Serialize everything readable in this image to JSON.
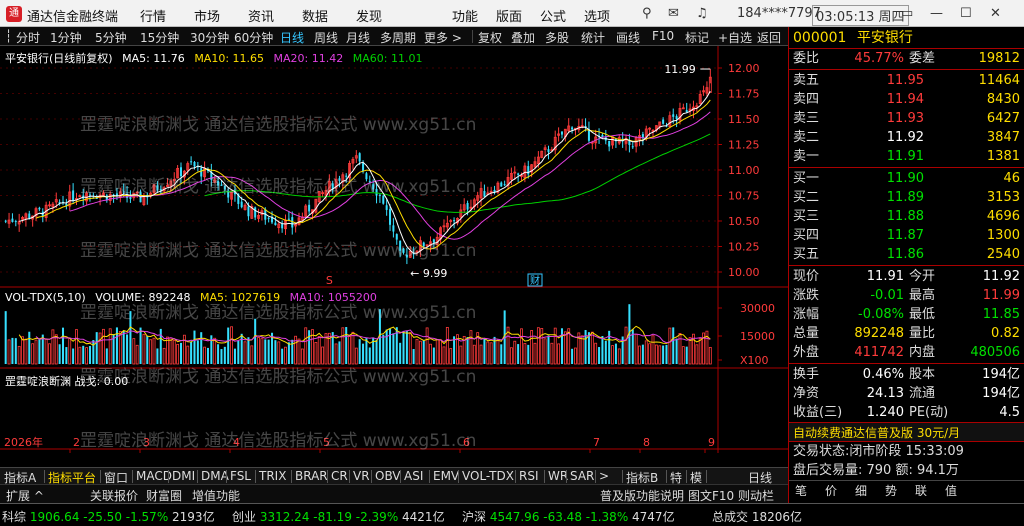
{
  "titlebar": {
    "logo": "通",
    "app_title": "通达信金融终端",
    "account": "184****7797",
    "time": "03:05:13 周四"
  },
  "menu": [
    "行情",
    "市场",
    "资讯",
    "数据",
    "发现",
    "功能",
    "版面",
    "公式",
    "选项"
  ],
  "toolbar": {
    "items": [
      "分时",
      "1分钟",
      "5分钟",
      "15分钟",
      "30分钟",
      "60分钟",
      "日线",
      "周线",
      "月线",
      "多周期",
      "更多 >",
      "复权",
      "叠加",
      "多股",
      "统计",
      "画线",
      "F10",
      "标记",
      "+自选",
      "返回"
    ],
    "active": "日线"
  },
  "chart": {
    "title": "平安银行(日线前复权)",
    "ma5": "MA5: 11.76",
    "ma10": "MA10: 11.65",
    "ma20": "MA20: 11.42",
    "ma60": "MA60: 11.01",
    "high_label": "11.99",
    "low_label": "9.99",
    "s_mark": "S",
    "cai_mark": "财",
    "year": "2026年",
    "months": [
      "2",
      "3",
      "4",
      "5",
      "6",
      "7",
      "8",
      "9"
    ],
    "price_ticks": [
      "12.00",
      "11.75",
      "11.50",
      "11.25",
      "11.00",
      "10.75",
      "10.50",
      "10.25",
      "10.00"
    ],
    "vol_legend": "VOL-TDX(5,10)",
    "volume": "VOLUME: 892248",
    "vol_ma5": "MA5: 1027619",
    "vol_ma10": "MA10: 1055200",
    "vol_ticks": [
      "30000",
      "15000",
      "X100"
    ],
    "ind_legend": "罡霆啶浪断渊 战戈: 0.00",
    "watermark": "罡霆啶浪断渊戈 通达信选股指标公式 www.xg51.cn"
  },
  "quote": {
    "code": "000001",
    "name": "平安银行",
    "weibi_label": "委比",
    "weibi": "45.77%",
    "weicha_label": "委差",
    "weicha": "19812",
    "sells": [
      {
        "label": "卖五",
        "price": "11.95",
        "vol": "11464"
      },
      {
        "label": "卖四",
        "price": "11.94",
        "vol": "8430"
      },
      {
        "label": "卖三",
        "price": "11.93",
        "vol": "6427"
      },
      {
        "label": "卖二",
        "price": "11.92",
        "vol": "3847"
      },
      {
        "label": "卖一",
        "price": "11.91",
        "vol": "1381"
      }
    ],
    "buys": [
      {
        "label": "买一",
        "price": "11.90",
        "vol": "46"
      },
      {
        "label": "买二",
        "price": "11.89",
        "vol": "3153"
      },
      {
        "label": "买三",
        "price": "11.88",
        "vol": "4696"
      },
      {
        "label": "买四",
        "price": "11.87",
        "vol": "1300"
      },
      {
        "label": "买五",
        "price": "11.86",
        "vol": "2540"
      }
    ],
    "stats": [
      {
        "l1": "现价",
        "v1": "11.91",
        "c1": "white",
        "l2": "今开",
        "v2": "11.92",
        "c2": "white"
      },
      {
        "l1": "涨跌",
        "v1": "-0.01",
        "c1": "green",
        "l2": "最高",
        "v2": "11.99",
        "c2": "red"
      },
      {
        "l1": "涨幅",
        "v1": "-0.08%",
        "c1": "green",
        "l2": "最低",
        "v2": "11.85",
        "c2": "green"
      },
      {
        "l1": "总量",
        "v1": "892248",
        "c1": "yellow",
        "l2": "量比",
        "v2": "0.82",
        "c2": "yellow"
      },
      {
        "l1": "外盘",
        "v1": "411742",
        "c1": "red",
        "l2": "内盘",
        "v2": "480506",
        "c2": "green"
      }
    ],
    "stats2": [
      {
        "l1": "换手",
        "v1": "0.46%",
        "l2": "股本",
        "v2": "194亿"
      },
      {
        "l1": "净资",
        "v1": "24.13",
        "l2": "流通",
        "v2": "194亿"
      },
      {
        "l1": "收益(三)",
        "v1": "1.240",
        "l2": "PE(动)",
        "v2": "4.5"
      }
    ],
    "ad": "自动续费通达信普及版 30元/月",
    "trade_status": "交易状态:闭市阶段 15:33:09",
    "post_trade": "盘后交易量: 790 额: 94.1万",
    "side_tabs": [
      "笔",
      "价",
      "细",
      "势",
      "联",
      "值"
    ]
  },
  "bottom_tabs": [
    "指标A",
    "指标平台",
    "窗口",
    "MACD",
    "DMI",
    "DMA",
    "FSL",
    "TRIX",
    "BRAR",
    "CR",
    "VR",
    "OBV",
    "ASI",
    "EMV",
    "VOL-TDX",
    "RSI",
    "WR",
    "SAR",
    ">",
    "指标B",
    "特",
    "模",
    "日线"
  ],
  "bottom_bar": {
    "expand": "扩展 ^",
    "link": "关联报价",
    "wealth": "财富圈",
    "value_func": "增值功能",
    "news": "普及版功能说明",
    "f10": "图文F10 则动栏 ≪"
  },
  "status": [
    {
      "name": "科综",
      "value": "1906.64",
      "change": "-25.50",
      "pct": "-1.57%",
      "amount": "2193亿"
    },
    {
      "name": "创业",
      "value": "3312.24",
      "change": "-81.19",
      "pct": "-2.39%",
      "amount": "4421亿"
    },
    {
      "name": "沪深",
      "value": "4547.96",
      "change": "-63.48",
      "pct": "-1.38%",
      "amount": "4747亿"
    },
    {
      "name": "总成交",
      "value": "",
      "change": "",
      "pct": "",
      "amount": "18206亿"
    }
  ],
  "colors": {
    "up": "#ff3b3b",
    "down": "#36e0ff",
    "ma5": "#ffffff",
    "ma10": "#ffde00",
    "ma20": "#e040e0",
    "ma60": "#00d000"
  }
}
